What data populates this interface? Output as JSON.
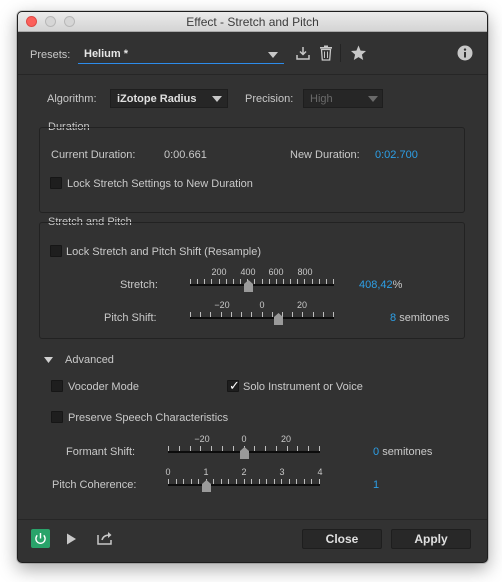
{
  "window": {
    "title": "Effect - Stretch and Pitch"
  },
  "presets": {
    "label": "Presets:",
    "value": "Helium *"
  },
  "algorithm": {
    "label": "Algorithm:",
    "value": "iZotope Radius"
  },
  "precision": {
    "label": "Precision:",
    "value": "High"
  },
  "duration": {
    "title": "Duration",
    "current_label": "Current Duration:",
    "current_value": "0:00.661",
    "new_label": "New Duration:",
    "new_value": "0:02.700",
    "lock_label": "Lock Stretch Settings to New Duration",
    "lock_checked": false
  },
  "stretch_pitch": {
    "title": "Stretch and Pitch",
    "lock_label": "Lock Stretch and Pitch Shift (Resample)",
    "lock_checked": false,
    "stretch": {
      "label": "Stretch:",
      "ticks": [
        "200",
        "400",
        "600",
        "800"
      ],
      "value": "408,42",
      "unit": "%",
      "numeric": 408.42
    },
    "pitch": {
      "label": "Pitch Shift:",
      "ticks": [
        "−20",
        "0",
        "20"
      ],
      "value": "8",
      "unit": "semitones",
      "numeric": 8
    }
  },
  "advanced": {
    "label": "Advanced",
    "vocoder_label": "Vocoder Mode",
    "vocoder_checked": false,
    "solo_label": "Solo Instrument or Voice",
    "solo_checked": true,
    "preserve_label": "Preserve Speech Characteristics",
    "preserve_checked": false,
    "formant": {
      "label": "Formant Shift:",
      "ticks": [
        "−20",
        "0",
        "20"
      ],
      "value": "0",
      "unit": "semitones",
      "numeric": 0
    },
    "coherence": {
      "label": "Pitch Coherence:",
      "ticks": [
        "0",
        "1",
        "2",
        "3",
        "4"
      ],
      "value": "1",
      "numeric": 1
    }
  },
  "footer": {
    "close_label": "Close",
    "apply_label": "Apply"
  },
  "colors": {
    "accent": "#2d9fe6",
    "power": "#29a36a",
    "background": "#323232"
  },
  "icons": [
    "download-icon",
    "trash-icon",
    "star-icon",
    "info-icon",
    "power-icon",
    "play-icon",
    "export-icon",
    "caret-down-icon",
    "triangle-down-icon"
  ]
}
